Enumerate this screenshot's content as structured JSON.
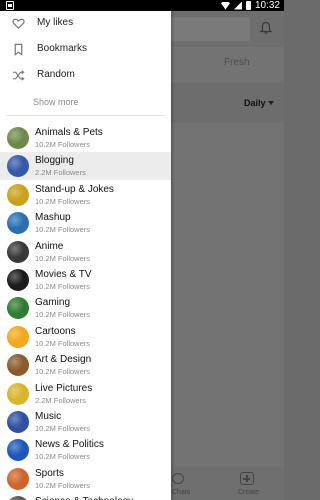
{
  "status_bar": {
    "time": "10:32"
  },
  "background": {
    "tab_fresh": "Fresh",
    "filter_value": "Daily",
    "bottom_nav": {
      "chats_label": "Chats",
      "create_label": "Create"
    }
  },
  "drawer": {
    "menu": [
      {
        "label": "My likes",
        "icon": "heart-icon"
      },
      {
        "label": "Bookmarks",
        "icon": "bookmark-icon"
      },
      {
        "label": "Random",
        "icon": "shuffle-icon"
      }
    ],
    "show_more": "Show more",
    "categories": [
      {
        "name": "Animals & Pets",
        "followers": "10.2M Followers",
        "color": "#6e8a4a"
      },
      {
        "name": "Blogging",
        "followers": "2.2M Followers",
        "color": "#3558a8",
        "selected": true
      },
      {
        "name": "Stand-up & Jokes",
        "followers": "10.2M Followers",
        "color": "#c9a21b"
      },
      {
        "name": "Mashup",
        "followers": "10.2M Followers",
        "color": "#2a6fb3"
      },
      {
        "name": "Anime",
        "followers": "10.2M Followers",
        "color": "#3a3a3a"
      },
      {
        "name": "Movies & TV",
        "followers": "10.2M Followers",
        "color": "#1c1c1c"
      },
      {
        "name": "Gaming",
        "followers": "10.2M Followers",
        "color": "#2e7d32"
      },
      {
        "name": "Cartoons",
        "followers": "10.2M Followers",
        "color": "#f2a81b"
      },
      {
        "name": "Art & Design",
        "followers": "10.2M Followers",
        "color": "#8a5a2b"
      },
      {
        "name": "Live Pictures",
        "followers": "2.2M Followers",
        "color": "#d8b52a"
      },
      {
        "name": "Music",
        "followers": "10.2M Followers",
        "color": "#2f4fa0"
      },
      {
        "name": "News & Politics",
        "followers": "10.2M Followers",
        "color": "#1f56b8"
      },
      {
        "name": "Sports",
        "followers": "10.2M Followers",
        "color": "#d0632a"
      },
      {
        "name": "Science & Technology",
        "followers": "",
        "color": "#555555"
      }
    ]
  }
}
